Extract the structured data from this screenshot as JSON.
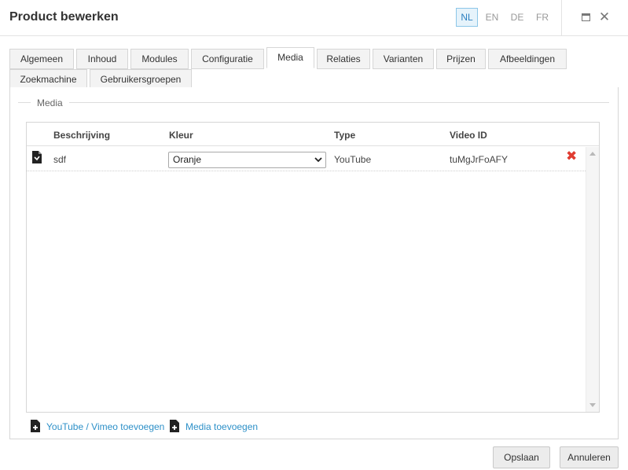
{
  "header": {
    "title": "Product bewerken",
    "languages": [
      {
        "code": "NL",
        "active": true
      },
      {
        "code": "EN",
        "active": false
      },
      {
        "code": "DE",
        "active": false
      },
      {
        "code": "FR",
        "active": false
      }
    ],
    "maximize_icon": "maximize-icon",
    "close_icon": "close-icon"
  },
  "tabs": [
    {
      "label": "Algemeen",
      "active": false
    },
    {
      "label": "Inhoud",
      "active": false
    },
    {
      "label": "Modules",
      "active": false
    },
    {
      "label": "Configuratie",
      "active": false
    },
    {
      "label": "Media",
      "active": true
    },
    {
      "label": "Relaties",
      "active": false
    },
    {
      "label": "Varianten",
      "active": false
    },
    {
      "label": "Prijzen",
      "active": false
    },
    {
      "label": "Afbeeldingen",
      "active": false
    },
    {
      "label": "Zoekmachine",
      "active": false
    },
    {
      "label": "Gebruikersgroepen",
      "active": false
    }
  ],
  "media_section": {
    "legend": "Media",
    "columns": {
      "description": "Beschrijving",
      "color": "Kleur",
      "type": "Type",
      "video_id": "Video ID"
    },
    "rows": [
      {
        "icon": "media-file-icon",
        "description": "sdf",
        "color": "Oranje",
        "type": "YouTube",
        "video_id": "tuMgJrFoAFY",
        "delete_icon": "delete-icon"
      }
    ]
  },
  "actions": {
    "add_video": "YouTube / Vimeo toevoegen",
    "add_media": "Media toevoegen"
  },
  "footer": {
    "save": "Opslaan",
    "cancel": "Annuleren"
  },
  "colors": {
    "accent": "#2d90c8",
    "active_lang_bg": "#e6f3fb",
    "delete": "#e03c31"
  }
}
